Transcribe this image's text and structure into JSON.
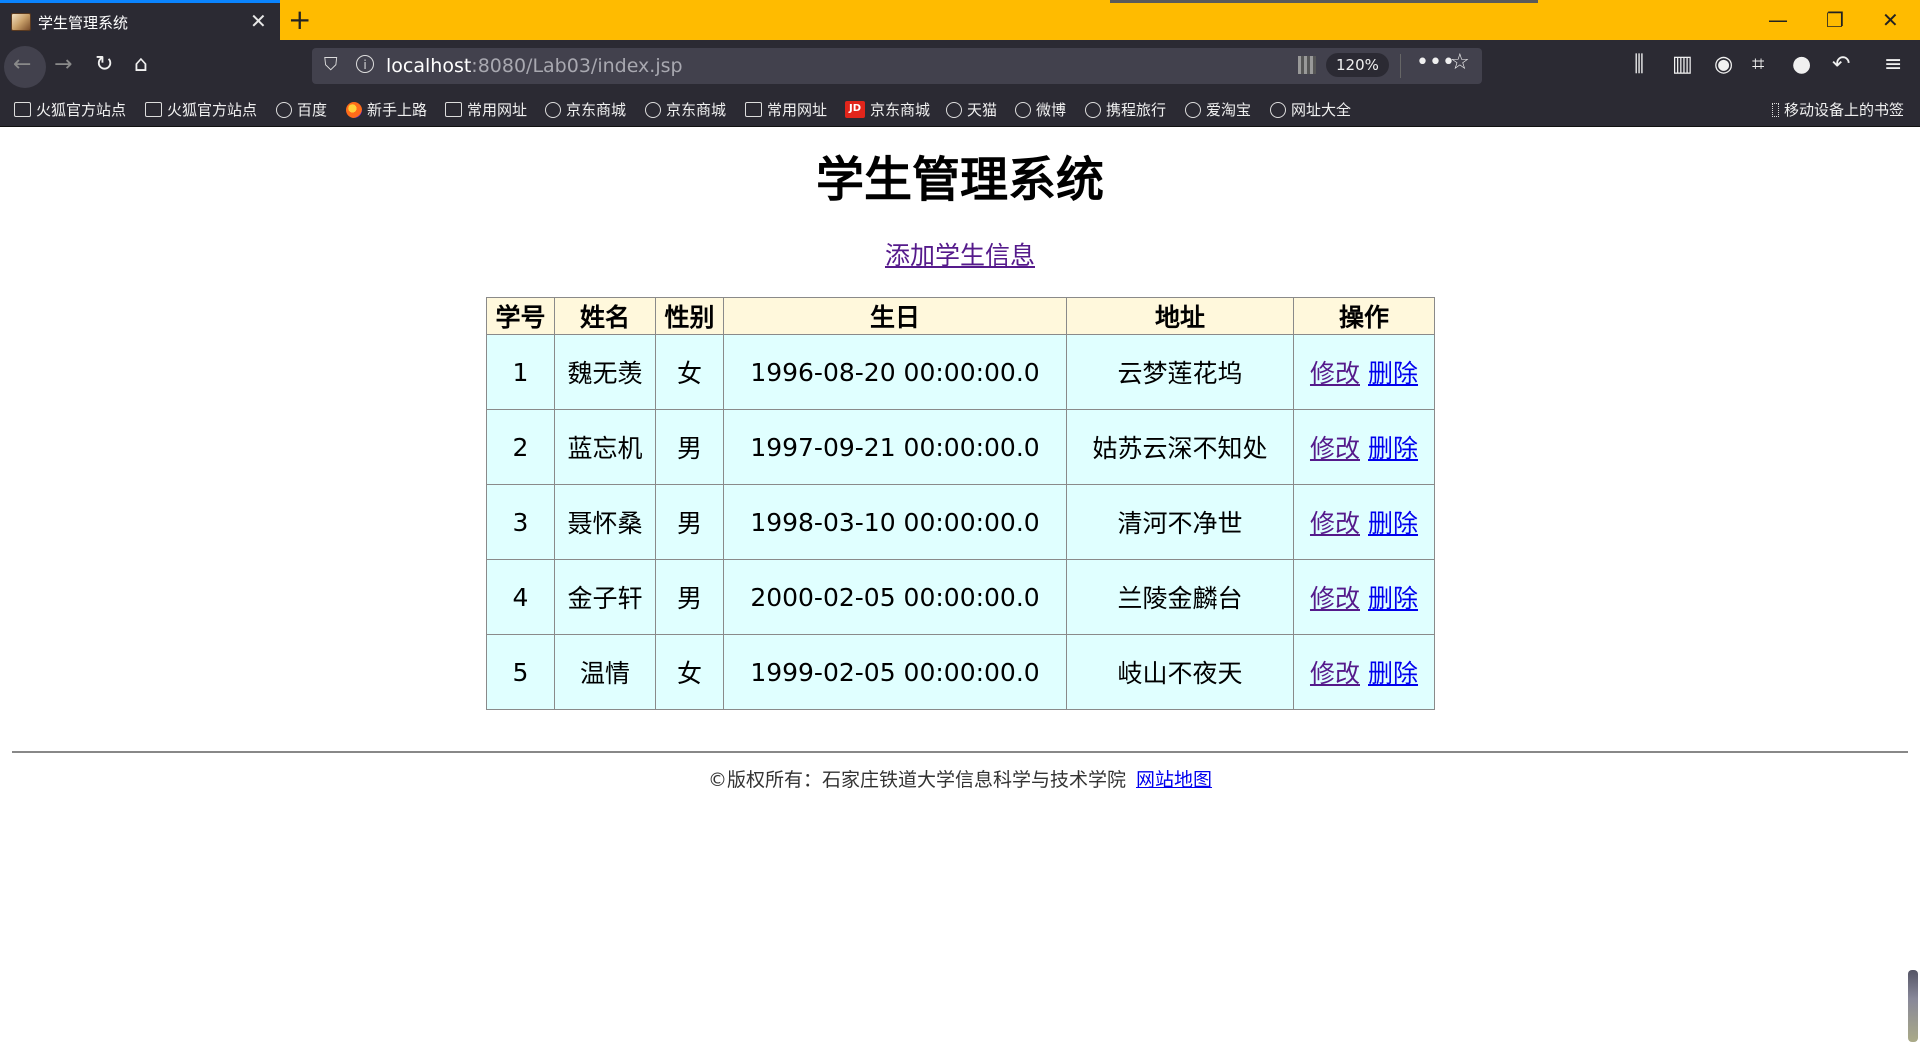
{
  "browser": {
    "tab_title": "学生管理系统",
    "tab_close": "✕",
    "new_tab": "+",
    "window_controls": {
      "minimize": "—",
      "restore": "❐",
      "close": "✕"
    },
    "url": {
      "host": "localhost",
      "rest": ":8080/Lab03/index.jsp"
    },
    "zoom": "120%",
    "more": "•••",
    "bookmarks": [
      {
        "label": "火狐官方站点",
        "icon": "folder-icon"
      },
      {
        "label": "火狐官方站点",
        "icon": "folder-icon"
      },
      {
        "label": "百度",
        "icon": "globe-icon"
      },
      {
        "label": "新手上路",
        "icon": "firefox-icon"
      },
      {
        "label": "常用网址",
        "icon": "folder-icon"
      },
      {
        "label": "京东商城",
        "icon": "globe-icon"
      },
      {
        "label": "京东商城",
        "icon": "globe-icon"
      },
      {
        "label": "常用网址",
        "icon": "folder-icon"
      },
      {
        "label": "京东商城",
        "icon": "jd-icon"
      },
      {
        "label": "天猫",
        "icon": "globe-icon"
      },
      {
        "label": "微博",
        "icon": "globe-icon"
      },
      {
        "label": "携程旅行",
        "icon": "globe-icon"
      },
      {
        "label": "爱淘宝",
        "icon": "globe-icon"
      },
      {
        "label": "网址大全",
        "icon": "globe-icon"
      }
    ],
    "jd_badge": "JD",
    "mobile_bookmarks": "移动设备上的书签",
    "colors": {
      "tabbar": "#ffbb00",
      "toolbar": "#2b2a33",
      "active_tab_accent": "#0a84ff"
    }
  },
  "page": {
    "title": "学生管理系统",
    "add_link": "添加学生信息",
    "table": {
      "headers": [
        "学号",
        "姓名",
        "性别",
        "生日",
        "地址",
        "操作"
      ],
      "rows": [
        {
          "id": "1",
          "name": "魏无羡",
          "gender": "女",
          "birthday": "1996-08-20 00:00:00.0",
          "address": "云梦莲花坞"
        },
        {
          "id": "2",
          "name": "蓝忘机",
          "gender": "男",
          "birthday": "1997-09-21 00:00:00.0",
          "address": "姑苏云深不知处"
        },
        {
          "id": "3",
          "name": "聂怀桑",
          "gender": "男",
          "birthday": "1998-03-10 00:00:00.0",
          "address": "清河不净世"
        },
        {
          "id": "4",
          "name": "金子轩",
          "gender": "男",
          "birthday": "2000-02-05 00:00:00.0",
          "address": "兰陵金麟台"
        },
        {
          "id": "5",
          "name": "温情",
          "gender": "女",
          "birthday": "1999-02-05 00:00:00.0",
          "address": "岐山不夜天"
        }
      ],
      "edit_label": "修改",
      "delete_label": "删除",
      "colors": {
        "header_bg": "#fff8dc",
        "cell_bg": "#e0ffff"
      }
    },
    "footer": {
      "copyright": "©版权所有：石家庄铁道大学信息科学与技术学院",
      "sitemap": "网站地图"
    }
  }
}
